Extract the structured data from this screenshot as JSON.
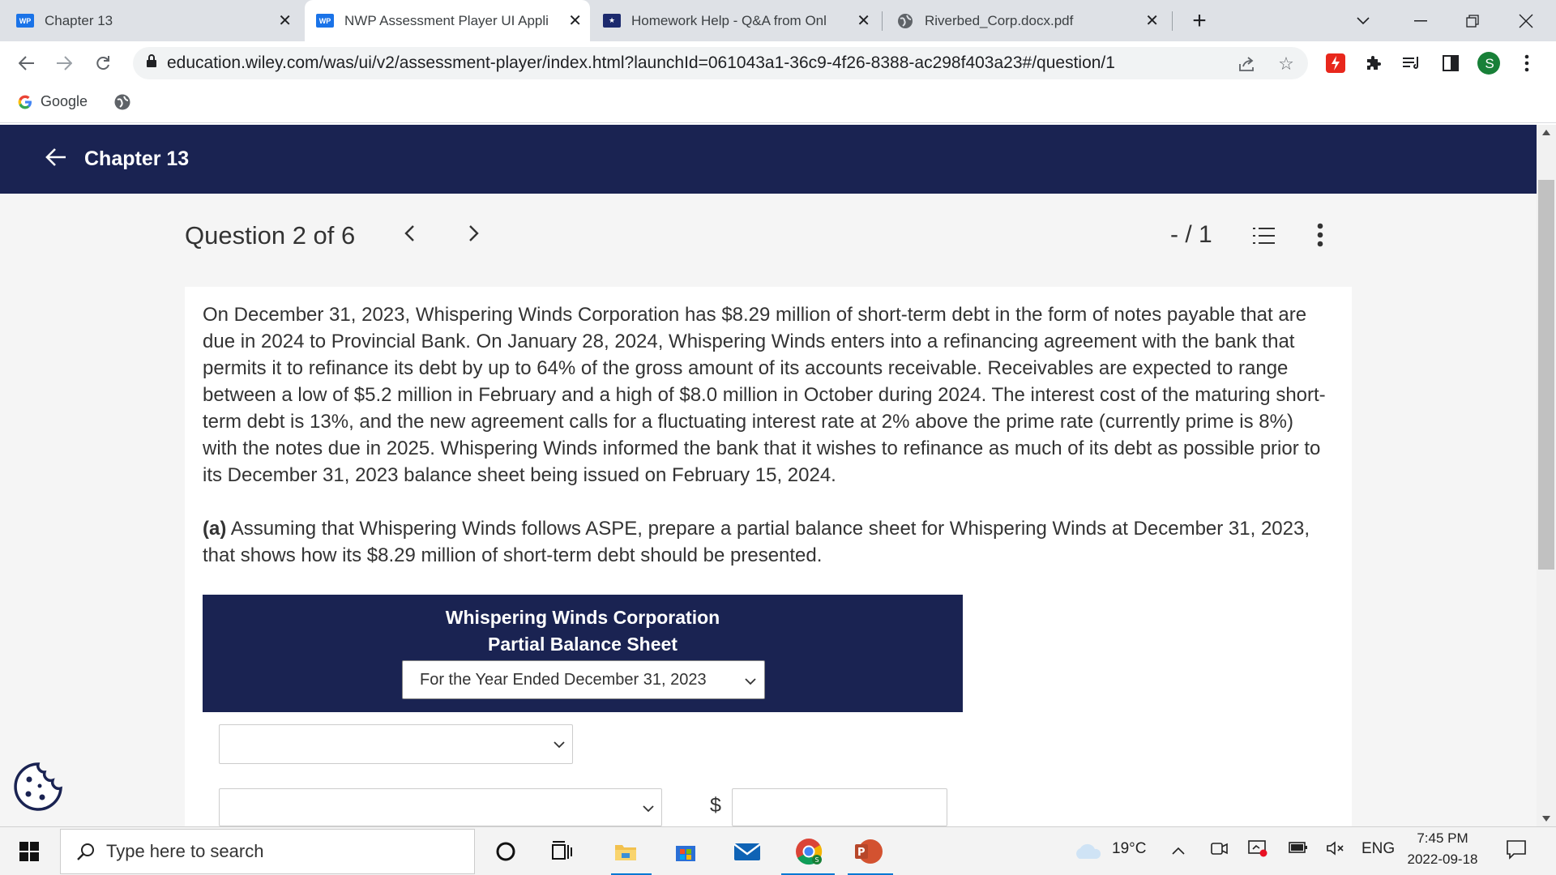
{
  "browser": {
    "tabs": [
      {
        "title": "Chapter 13",
        "favicon": "WP",
        "active": false
      },
      {
        "title": "NWP Assessment Player UI Appli",
        "favicon": "WP",
        "active": true
      },
      {
        "title": "Homework Help - Q&A from Onl",
        "favicon": "star-icon",
        "active": false
      },
      {
        "title": "Riverbed_Corp.docx.pdf",
        "favicon": "globe-icon",
        "active": false
      }
    ],
    "url": "education.wiley.com/was/ui/v2/assessment-player/index.html?launchId=061043a1-36c9-4f26-8388-ac298f403a23#/question/1",
    "profile_initial": "S",
    "bookmarks": [
      {
        "label": "Google"
      }
    ]
  },
  "header": {
    "title": "Chapter 13"
  },
  "question_bar": {
    "position": "Question 2 of 6",
    "score": "- / 1"
  },
  "question": {
    "paragraph": "On December 31, 2023, Whispering Winds Corporation has $8.29 million of short-term debt in the form of notes payable that are due in 2024 to Provincial Bank. On January 28, 2024, Whispering Winds enters into a refinancing agreement with the bank that permits it to refinance its debt by up to 64% of the gross amount of its accounts receivable. Receivables are expected to range between a low of $5.2 million in February and a high of $8.0 million in October during 2024. The interest cost of the maturing short-term debt is 13%, and the new agreement calls for a fluctuating interest rate at 2% above the prime rate (currently prime is 8%) with the notes due in 2025. Whispering Winds informed the bank that it wishes to refinance as much of its debt as possible prior to its December 31, 2023 balance sheet being issued on February 15, 2024.",
    "part_label": "(a)",
    "part_text": " Assuming that Whispering Winds follows ASPE, prepare a partial balance sheet for Whispering Winds at December 31, 2023, that shows how its $8.29 million of short-term debt should be presented."
  },
  "balance_sheet": {
    "company": "Whispering Winds Corporation",
    "statement": "Partial Balance Sheet",
    "period_selected": "For the Year Ended December 31, 2023",
    "row1_select": "",
    "row2_select": "",
    "currency_symbol": "$",
    "amount": ""
  },
  "taskbar": {
    "search_placeholder": "Type here to search",
    "weather": "19°C",
    "language": "ENG",
    "time": "7:45 PM",
    "date": "2022-09-18"
  },
  "colors": {
    "header_navy": "#1a2352",
    "accent_blue": "#1a73e8"
  }
}
